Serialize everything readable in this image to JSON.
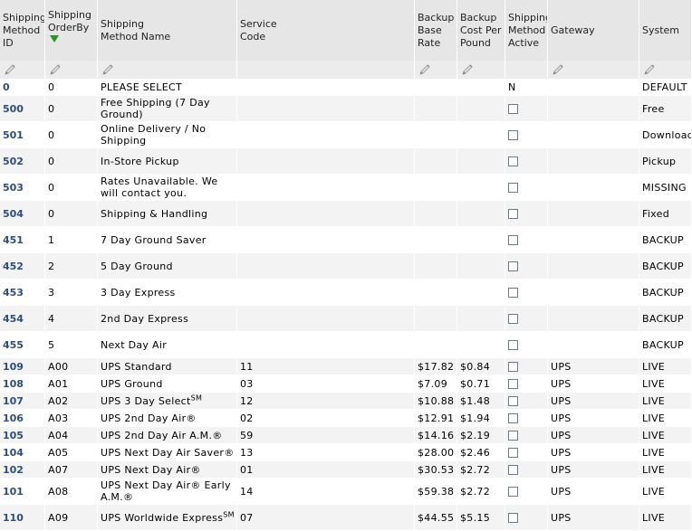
{
  "headers": [
    "Shipping Method ID",
    "Shipping OrderBy",
    "Shipping Method Name",
    "Service Code",
    "Backup Base Rate",
    "Backup Cost Per Pound",
    "Shipping Method Active",
    "Gateway",
    "System"
  ],
  "header_lines": {
    "id": [
      "Shipping",
      "Method",
      "ID"
    ],
    "orderby": [
      "Shipping",
      "OrderBy"
    ],
    "name": [
      "Shipping",
      "Method Name"
    ],
    "code": [
      "Service",
      "Code"
    ],
    "base": [
      "Backup",
      "Base",
      "Rate"
    ],
    "cpp": [
      "Backup",
      "Cost Per",
      "Pound"
    ],
    "active": [
      "Shipping",
      "Method",
      "Active"
    ],
    "gateway": [
      "Gateway"
    ],
    "system": [
      "System"
    ]
  },
  "icons": {
    "filter": "pencil-icon",
    "sort": "sort-descending-arrow-icon",
    "checkbox": "checkbox-icon"
  },
  "rows": [
    {
      "id": "0",
      "orderby": "0",
      "name": "PLEASE SELECT",
      "code": "",
      "base": "",
      "cpp": "",
      "active": "N",
      "gateway": "",
      "system": "DEFAULT",
      "checkbox": false,
      "h": "s"
    },
    {
      "id": "500",
      "orderby": "0",
      "name": "Free Shipping (7 Day Ground)",
      "code": "",
      "base": "",
      "cpp": "",
      "active": "",
      "gateway": "",
      "system": "Free",
      "checkbox": true,
      "h": "t"
    },
    {
      "id": "501",
      "orderby": "0",
      "name": "Online Delivery / No Shipping",
      "code": "",
      "base": "",
      "cpp": "",
      "active": "",
      "gateway": "",
      "system": "Download",
      "checkbox": true,
      "h": "t"
    },
    {
      "id": "502",
      "orderby": "0",
      "name": "In-Store Pickup",
      "code": "",
      "base": "",
      "cpp": "",
      "active": "",
      "gateway": "",
      "system": "Pickup",
      "checkbox": true,
      "h": "t"
    },
    {
      "id": "503",
      "orderby": "0",
      "name": "Rates Unavailable. We will contact you.",
      "code": "",
      "base": "",
      "cpp": "",
      "active": "",
      "gateway": "",
      "system": "MISSING",
      "checkbox": true,
      "h": "t"
    },
    {
      "id": "504",
      "orderby": "0",
      "name": "Shipping & Handling",
      "code": "",
      "base": "",
      "cpp": "",
      "active": "",
      "gateway": "",
      "system": "Fixed",
      "checkbox": true,
      "h": "t"
    },
    {
      "id": "451",
      "orderby": "1",
      "name": "7 Day Ground Saver",
      "code": "",
      "base": "",
      "cpp": "",
      "active": "",
      "gateway": "",
      "system": "BACKUP",
      "checkbox": true,
      "h": "t"
    },
    {
      "id": "452",
      "orderby": "2",
      "name": "5 Day Ground",
      "code": "",
      "base": "",
      "cpp": "",
      "active": "",
      "gateway": "",
      "system": "BACKUP",
      "checkbox": true,
      "h": "t"
    },
    {
      "id": "453",
      "orderby": "3",
      "name": "3 Day Express",
      "code": "",
      "base": "",
      "cpp": "",
      "active": "",
      "gateway": "",
      "system": "BACKUP",
      "checkbox": true,
      "h": "t"
    },
    {
      "id": "454",
      "orderby": "4",
      "name": "2nd Day Express",
      "code": "",
      "base": "",
      "cpp": "",
      "active": "",
      "gateway": "",
      "system": "BACKUP",
      "checkbox": true,
      "h": "t"
    },
    {
      "id": "455",
      "orderby": "5",
      "name": "Next Day Air",
      "code": "",
      "base": "",
      "cpp": "",
      "active": "",
      "gateway": "",
      "system": "BACKUP",
      "checkbox": true,
      "h": "t"
    },
    {
      "id": "109",
      "orderby": "A00",
      "name": "UPS Standard",
      "code": "11",
      "base": "$17.82",
      "cpp": "$0.84",
      "active": "",
      "gateway": "UPS",
      "system": "LIVE",
      "checkbox": true,
      "h": "s"
    },
    {
      "id": "108",
      "orderby": "A01",
      "name": "UPS Ground",
      "code": "03",
      "base": "$7.09",
      "cpp": "$0.71",
      "active": "",
      "gateway": "UPS",
      "system": "LIVE",
      "checkbox": true,
      "h": "s"
    },
    {
      "id": "107",
      "orderby": "A02",
      "name": "UPS 3 Day Select",
      "name_sup": "SM",
      "code": "12",
      "base": "$10.88",
      "cpp": "$1.48",
      "active": "",
      "gateway": "UPS",
      "system": "LIVE",
      "checkbox": true,
      "h": "s"
    },
    {
      "id": "106",
      "orderby": "A03",
      "name": "UPS 2nd Day Air®",
      "code": "02",
      "base": "$12.91",
      "cpp": "$1.94",
      "active": "",
      "gateway": "UPS",
      "system": "LIVE",
      "checkbox": true,
      "h": "s"
    },
    {
      "id": "105",
      "orderby": "A04",
      "name": "UPS 2nd Day Air A.M.®",
      "code": "59",
      "base": "$14.16",
      "cpp": "$2.19",
      "active": "",
      "gateway": "UPS",
      "system": "LIVE",
      "checkbox": true,
      "h": "s"
    },
    {
      "id": "104",
      "orderby": "A05",
      "name": "UPS Next Day Air Saver®",
      "code": "13",
      "base": "$28.00",
      "cpp": "$2.46",
      "active": "",
      "gateway": "UPS",
      "system": "LIVE",
      "checkbox": true,
      "h": "s"
    },
    {
      "id": "102",
      "orderby": "A07",
      "name": "UPS Next Day Air®",
      "code": "01",
      "base": "$30.53",
      "cpp": "$2.72",
      "active": "",
      "gateway": "UPS",
      "system": "LIVE",
      "checkbox": true,
      "h": "s"
    },
    {
      "id": "101",
      "orderby": "A08",
      "name": "UPS Next Day Air® Early A.M.®",
      "code": "14",
      "base": "$59.38",
      "cpp": "$2.72",
      "active": "",
      "gateway": "UPS",
      "system": "LIVE",
      "checkbox": true,
      "h": "t"
    },
    {
      "id": "110",
      "orderby": "A09",
      "name": "UPS Worldwide Express",
      "name_sup": "SM",
      "code": "07",
      "base": "$44.55",
      "cpp": "$5.15",
      "active": "",
      "gateway": "UPS",
      "system": "LIVE",
      "checkbox": true,
      "h": "t"
    }
  ]
}
